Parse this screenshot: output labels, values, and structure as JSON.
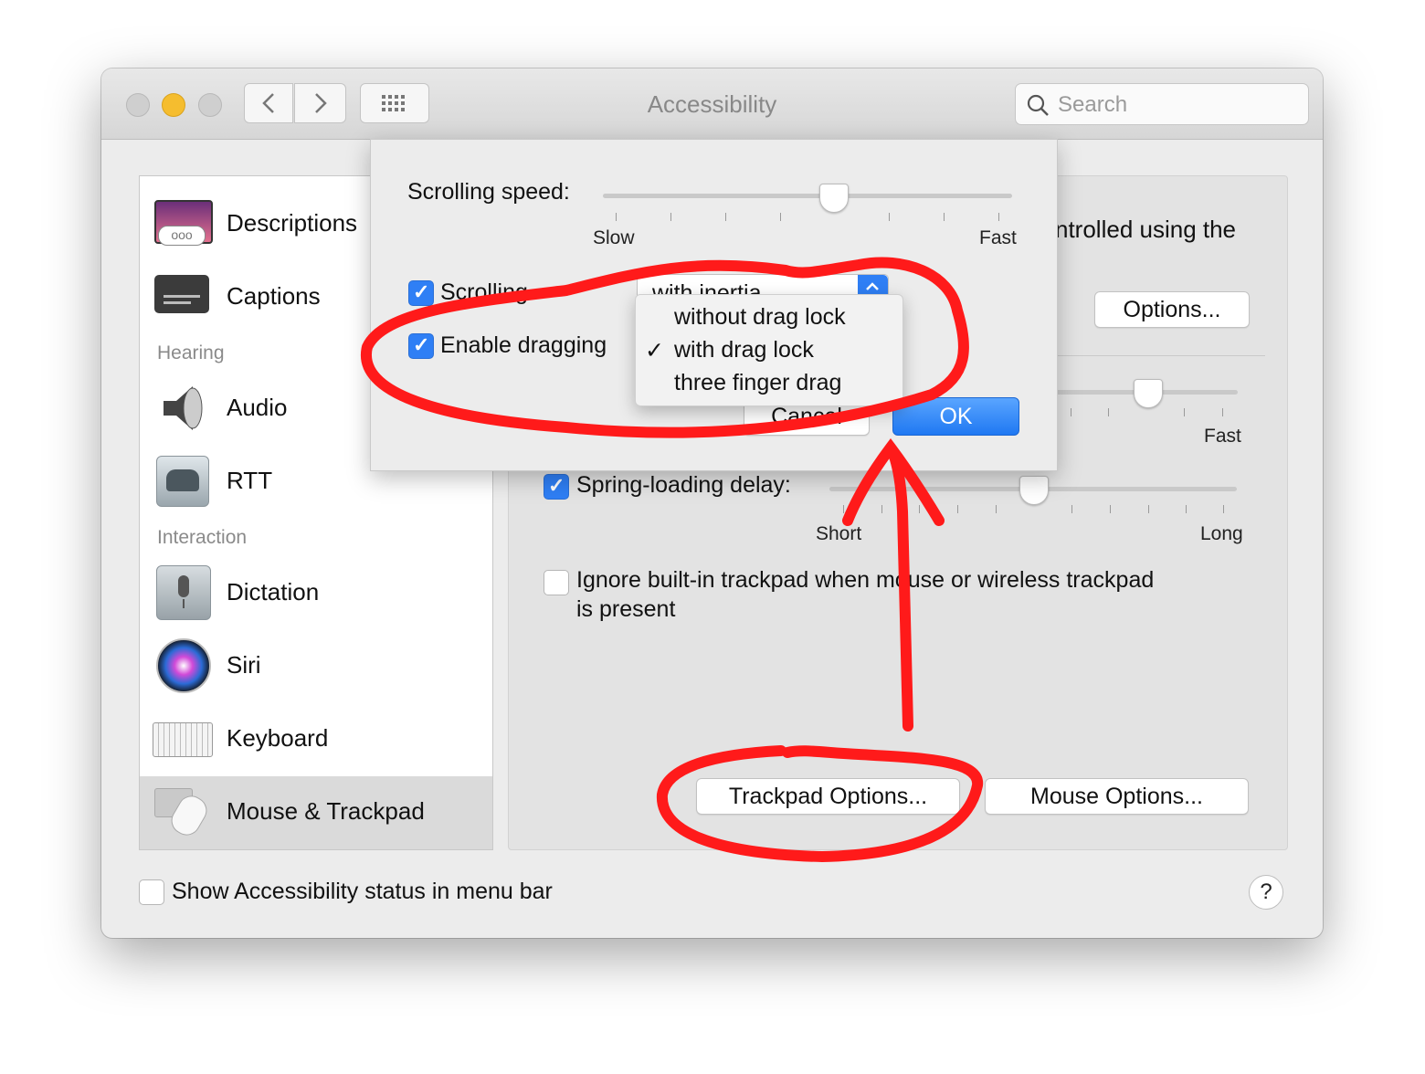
{
  "window": {
    "title": "Accessibility",
    "search_placeholder": "Search"
  },
  "sidebar": {
    "items": [
      {
        "label": "Descriptions"
      },
      {
        "label": "Captions"
      },
      {
        "label": "Hearing"
      },
      {
        "label": "Audio"
      },
      {
        "label": "RTT"
      },
      {
        "label": "Interaction"
      },
      {
        "label": "Dictation"
      },
      {
        "label": "Siri"
      },
      {
        "label": "Keyboard"
      },
      {
        "label": "Mouse & Trackpad"
      }
    ],
    "selected": "Mouse & Trackpad"
  },
  "pane": {
    "partial_text": "ntrolled using the",
    "options_button": "Options...",
    "double_click_fast": "Fast",
    "spring_loading_label": "Spring-loading delay:",
    "spring_loading_checked": true,
    "spring_short": "Short",
    "spring_long": "Long",
    "ignore_trackpad_label": "Ignore built-in trackpad when mouse or wireless trackpad",
    "ignore_trackpad_label2": "is present",
    "ignore_trackpad_checked": false,
    "trackpad_options_button": "Trackpad Options...",
    "mouse_options_button": "Mouse Options..."
  },
  "footer": {
    "status_label": "Show Accessibility status in menu bar",
    "status_checked": false,
    "help": "?"
  },
  "sheet": {
    "scrolling_speed_label": "Scrolling speed:",
    "slow": "Slow",
    "fast": "Fast",
    "scrolling_label": "Scrolling",
    "scrolling_checked": true,
    "scrolling_popup_value": "with inertia",
    "enable_dragging_label": "Enable dragging",
    "enable_dragging_checked": true,
    "cancel_button": "Cancel",
    "ok_button": "OK",
    "drag_menu": [
      {
        "label": "without drag lock",
        "checked": false
      },
      {
        "label": "with drag lock",
        "checked": true
      },
      {
        "label": "three finger drag",
        "checked": false
      }
    ],
    "check_glyph": "✓"
  },
  "colors": {
    "annotation": "#ff1a1a",
    "accent": "#2f7ff5"
  }
}
